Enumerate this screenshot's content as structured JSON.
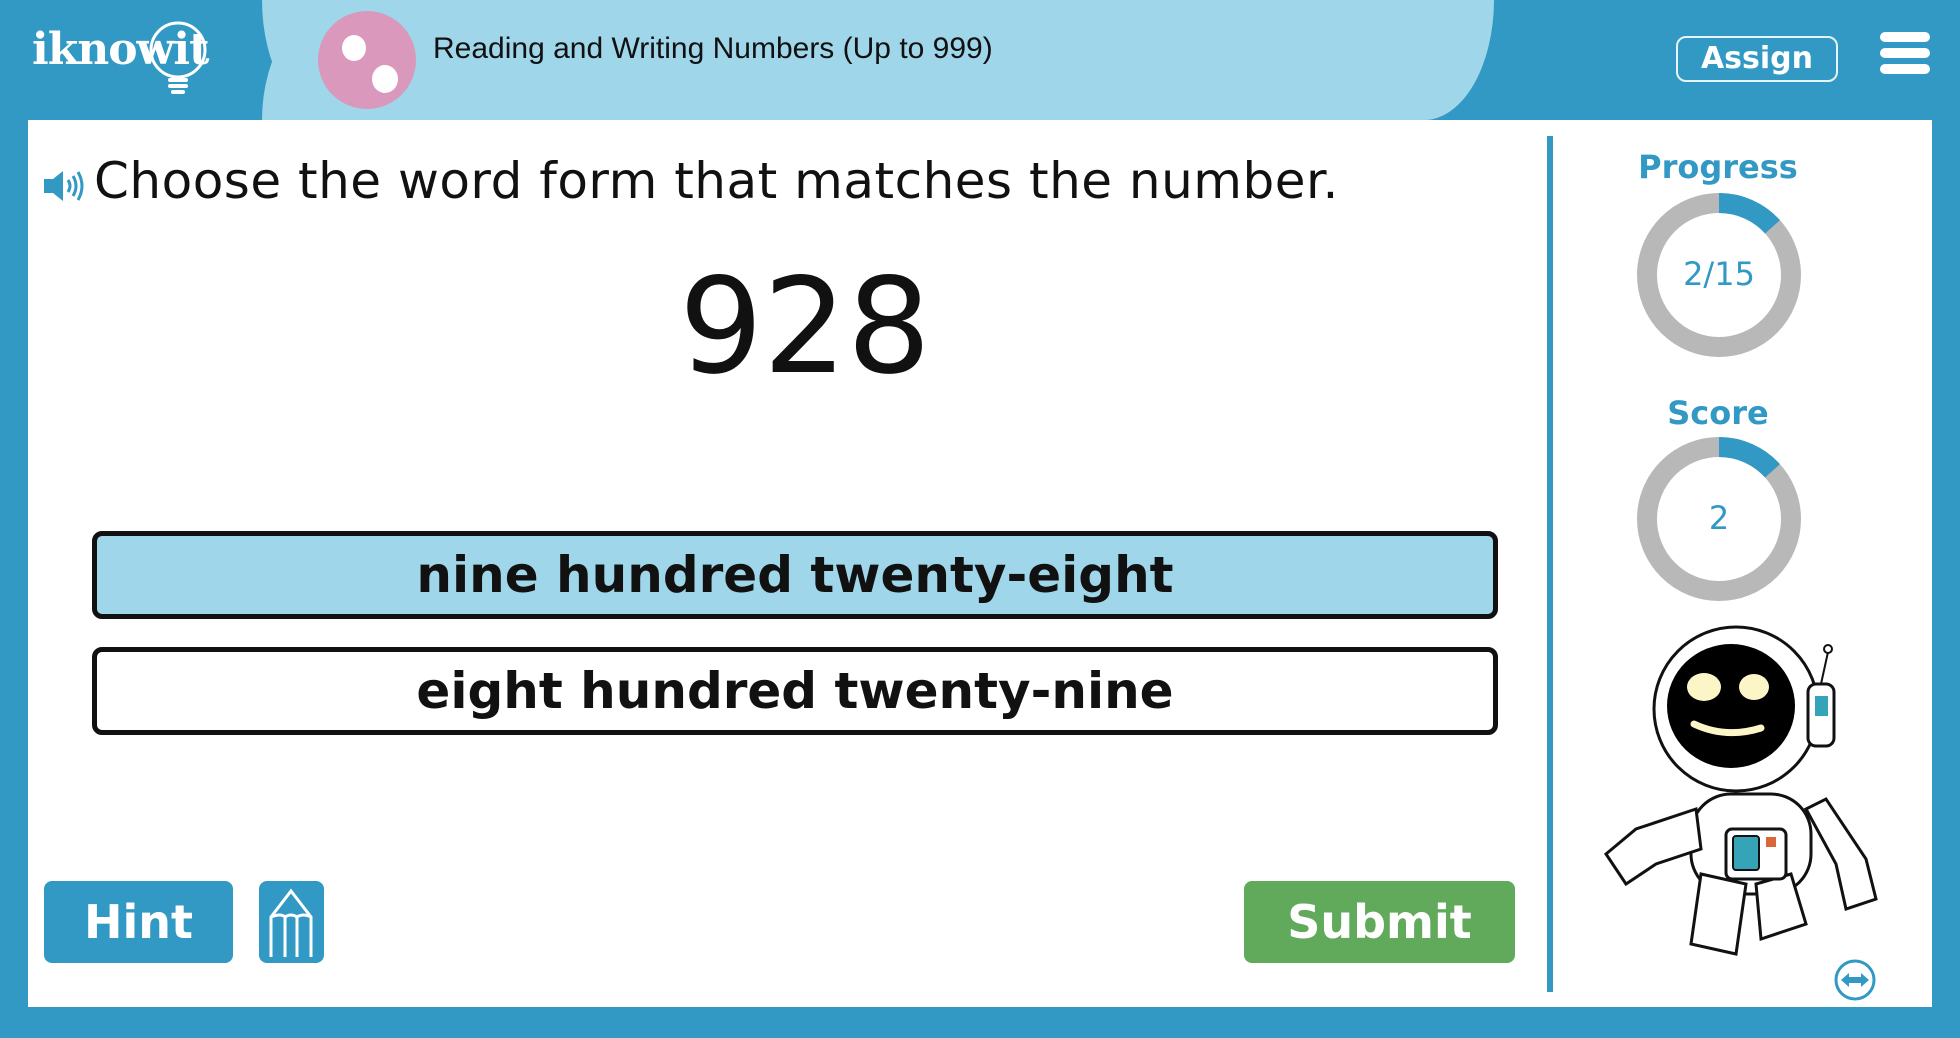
{
  "header": {
    "logo_text": "iknowit",
    "topic_title": "Reading and Writing Numbers (Up to 999)",
    "assign_label": "Assign",
    "menu_icon": "hamburger-menu-icon",
    "topic_icon": "two-dots-topic-icon"
  },
  "question": {
    "speaker_icon": "speaker-icon",
    "prompt": "Choose the word form that matches the number.",
    "number": "928",
    "options": [
      {
        "label": "nine hundred twenty-eight",
        "selected": true
      },
      {
        "label": "eight hundred twenty-nine",
        "selected": false
      }
    ]
  },
  "actions": {
    "hint_label": "Hint",
    "pencil_icon": "pencil-scratchpad-icon",
    "submit_label": "Submit"
  },
  "sidebar": {
    "progress": {
      "label": "Progress",
      "value_text": "2/15",
      "current": 2,
      "total": 15
    },
    "score": {
      "label": "Score",
      "value_text": "2",
      "fraction": 0.1333
    },
    "mascot": "astronaut-mascot",
    "swap_icon": "swap-horizontal-icon"
  },
  "colors": {
    "primary_blue": "#3199c3",
    "light_blue": "#9fd6e9",
    "topic_pink": "#da98bc",
    "submit_green": "#61a95b",
    "ring_gray": "#b8b8b8"
  }
}
